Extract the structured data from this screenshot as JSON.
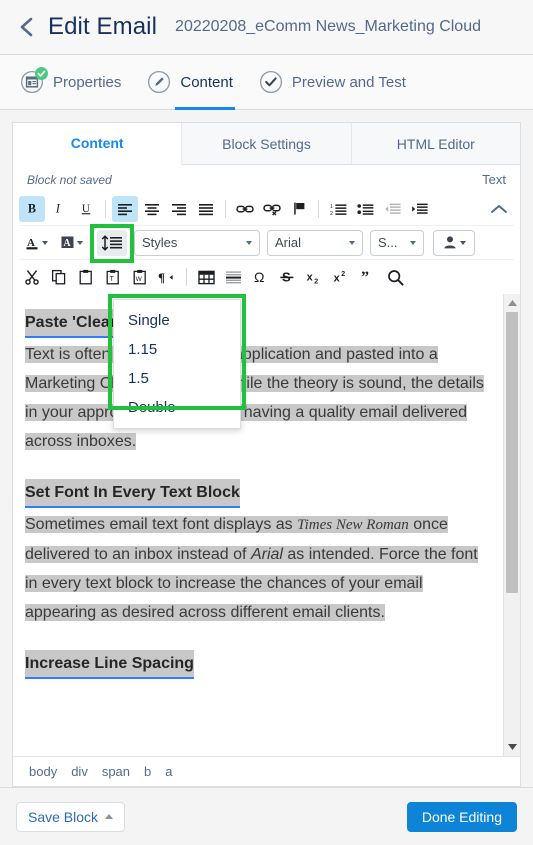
{
  "header": {
    "back_icon": "chevron-left-icon",
    "title": "Edit Email",
    "email_name": "20220208_eComm News_Marketing Cloud"
  },
  "steps": [
    {
      "label": "Properties",
      "icon": "properties-icon",
      "complete": true,
      "active": false
    },
    {
      "label": "Content",
      "icon": "pencil-icon",
      "complete": false,
      "active": true
    },
    {
      "label": "Preview and Test",
      "icon": "check-circle-icon",
      "complete": false,
      "active": false
    }
  ],
  "card": {
    "tabs": [
      {
        "label": "Content",
        "active": true
      },
      {
        "label": "Block Settings",
        "active": false
      },
      {
        "label": "HTML Editor",
        "active": false
      }
    ],
    "status_left": "Block not saved",
    "status_right": "Text"
  },
  "toolbar": {
    "row1": [
      {
        "name": "bold-button",
        "glyph": "B",
        "active": true
      },
      {
        "name": "italic-button",
        "glyph": "I",
        "active": false
      },
      {
        "name": "underline-button",
        "glyph": "U",
        "active": false
      },
      {
        "name": "align-left-button",
        "active": true
      },
      {
        "name": "align-center-button",
        "active": false
      },
      {
        "name": "align-right-button",
        "active": false
      },
      {
        "name": "align-justify-button",
        "active": false
      },
      {
        "name": "insert-link-button",
        "active": false
      },
      {
        "name": "unlink-button",
        "active": false
      },
      {
        "name": "anchor-flag-button",
        "active": false
      },
      {
        "name": "numbered-list-button",
        "active": false
      },
      {
        "name": "bullet-list-button",
        "active": false
      },
      {
        "name": "outdent-button",
        "active": false,
        "disabled": true
      },
      {
        "name": "indent-button",
        "active": false
      }
    ],
    "collapse_icon": "chevron-up-icon",
    "row2": {
      "text-color-button": "A",
      "highlight-color-button": "A",
      "line-spacing-button": "line-spacing-icon",
      "styles_select": "Styles",
      "font_select": "Arial",
      "size_select": "S...",
      "personalization_button": "person-icon"
    },
    "row3": [
      {
        "name": "cut-button"
      },
      {
        "name": "copy-button"
      },
      {
        "name": "paste-button"
      },
      {
        "name": "paste-text-button"
      },
      {
        "name": "paste-word-button"
      },
      {
        "name": "text-direction-button"
      },
      {
        "name": "insert-table-button"
      },
      {
        "name": "horizontal-rule-button"
      },
      {
        "name": "special-character-button",
        "glyph": "Ω"
      },
      {
        "name": "strikethrough-button",
        "glyph": "S"
      },
      {
        "name": "subscript-button"
      },
      {
        "name": "superscript-button"
      },
      {
        "name": "blockquote-button",
        "glyph": "”"
      },
      {
        "name": "find-replace-button"
      }
    ]
  },
  "line_spacing_menu": {
    "items": [
      "Single",
      "1.15",
      "1.5",
      "Double"
    ],
    "highlight_color": "#22c03c"
  },
  "editor": {
    "sections": [
      {
        "heading": "Paste 'Clear'",
        "body": "Text is often copied from one application and pasted into a Marketing Cloud text block. While the theory is sound, the details in your approach are critical to having a quality email delivered across inboxes."
      },
      {
        "heading": "Set Font In Every Text Block",
        "body_1": "Sometimes email text font displays as ",
        "body_em_1": "Times New Roman",
        "body_2": " once delivered to an inbox instead of ",
        "body_em_2": "Arial",
        "body_3": " as intended. Force the font in every text block to increase the chances of your email appearing as desired across different email clients."
      },
      {
        "heading": "Increase Line Spacing"
      }
    ]
  },
  "element_path": [
    "body",
    "div",
    "span",
    "b",
    "a"
  ],
  "footer": {
    "save_label": "Save Block",
    "done_label": "Done Editing",
    "done_color": "#0d84d8"
  }
}
